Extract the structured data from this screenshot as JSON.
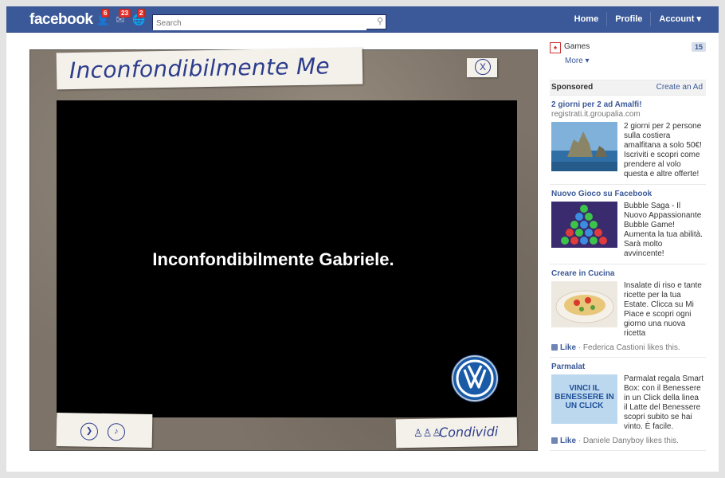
{
  "topbar": {
    "logo": "facebook",
    "badges": {
      "friends": "6",
      "messages": "23",
      "notifications": "2"
    },
    "search_placeholder": "Search",
    "nav": {
      "home": "Home",
      "profile": "Profile",
      "account": "Account ▾"
    }
  },
  "game": {
    "title": "Inconfondibilmente Me",
    "close_label": "X",
    "screen_text": "Inconfondibilmente Gabriele.",
    "share_label": "Condividi"
  },
  "sidebar": {
    "games": {
      "label": "Games",
      "count": "15"
    },
    "more": "More ▾",
    "sponsored": "Sponsored",
    "create_ad": "Create an Ad",
    "ads": [
      {
        "title": "2 giorni per 2 ad Amalfi!",
        "url": "registrati.it.groupalia.com",
        "text": "2 giorni per 2 persone sulla costiera amalfitana a solo 50€! Iscriviti e scopri come prendere al volo questa e altre offerte!"
      },
      {
        "title": "Nuovo Gioco su Facebook",
        "text": "Bubble Saga - Il Nuovo Appassionante Bubble Game! Aumenta la tua abilità. Sarà molto avvincente!"
      },
      {
        "title": "Creare in Cucina",
        "text": "Insalate di riso e tante ricette per la tua Estate. Clicca su Mi Piace e scopri ogni giorno una nuova ricetta",
        "like": "Like",
        "like_text": " · Federica Castioni likes this."
      },
      {
        "title": "Parmalat",
        "text": "Parmalat regala Smart Box: con il Benessere in un Click della linea il Latte del Benessere scopri subito se hai vinto. È facile.",
        "img_text": "VINCI IL BENESSERE IN UN CLICK",
        "like": "Like",
        "like_text": " · Daniele Danyboy likes this."
      }
    ]
  },
  "colors": {
    "fb_blue": "#3b5998",
    "link_blue": "#3b5998",
    "badge_red": "#e4312a"
  }
}
